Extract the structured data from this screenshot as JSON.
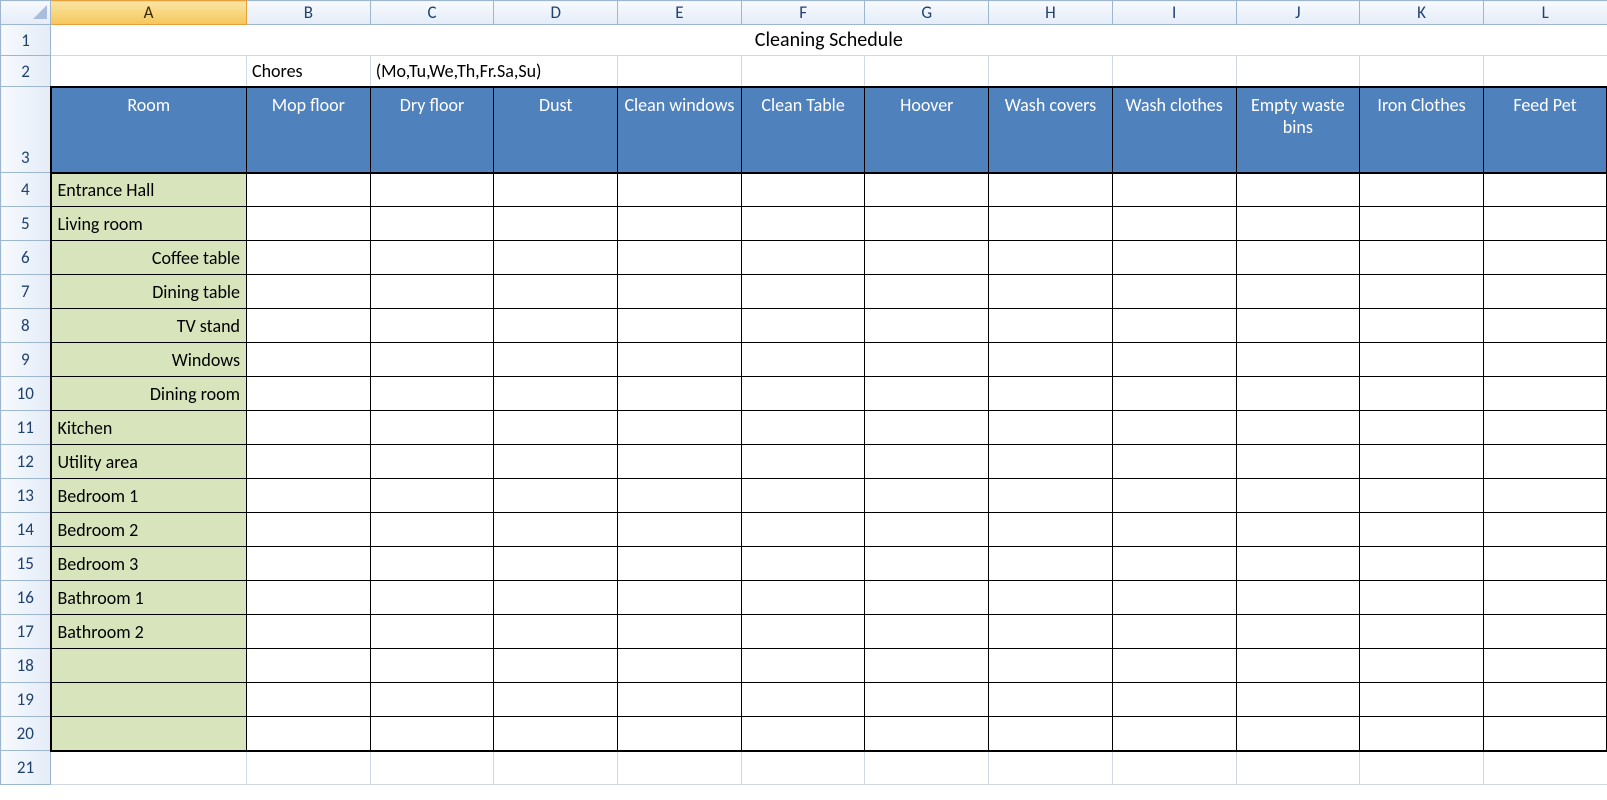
{
  "columns": [
    "A",
    "B",
    "C",
    "D",
    "E",
    "F",
    "G",
    "H",
    "I",
    "J",
    "K",
    "L"
  ],
  "row_numbers": [
    1,
    2,
    3,
    4,
    5,
    6,
    7,
    8,
    9,
    10,
    11,
    12,
    13,
    14,
    15,
    16,
    17,
    18,
    19,
    20,
    21
  ],
  "title": "Cleaning Schedule",
  "row2": {
    "B": "Chores",
    "C": "(Mo,Tu,We,Th,Fr.Sa,Su)"
  },
  "headers": {
    "A": "Room",
    "B": "Mop floor",
    "C": "Dry floor",
    "D": "Dust",
    "E": "Clean windows",
    "F": "Clean Table",
    "G": "Hoover",
    "H": "Wash covers",
    "I": "Wash clothes",
    "J": "Empty waste bins",
    "K": "Iron Clothes",
    "L": "Feed Pet"
  },
  "rooms": [
    {
      "row": 4,
      "label": "Entrance Hall",
      "indent": false
    },
    {
      "row": 5,
      "label": "Living room",
      "indent": false
    },
    {
      "row": 6,
      "label": "Coffee table",
      "indent": true
    },
    {
      "row": 7,
      "label": "Dining table",
      "indent": true
    },
    {
      "row": 8,
      "label": "TV stand",
      "indent": true
    },
    {
      "row": 9,
      "label": "Windows",
      "indent": true
    },
    {
      "row": 10,
      "label": "Dining room",
      "indent": true
    },
    {
      "row": 11,
      "label": "Kitchen",
      "indent": false
    },
    {
      "row": 12,
      "label": "Utility area",
      "indent": false
    },
    {
      "row": 13,
      "label": "Bedroom 1",
      "indent": false
    },
    {
      "row": 14,
      "label": "Bedroom 2",
      "indent": false
    },
    {
      "row": 15,
      "label": "Bedroom 3",
      "indent": false
    },
    {
      "row": 16,
      "label": "Bathroom 1",
      "indent": false
    },
    {
      "row": 17,
      "label": "Bathroom 2",
      "indent": false
    },
    {
      "row": 18,
      "label": "",
      "indent": false
    },
    {
      "row": 19,
      "label": "",
      "indent": false
    },
    {
      "row": 20,
      "label": "",
      "indent": false
    }
  ],
  "selected_column": "A"
}
